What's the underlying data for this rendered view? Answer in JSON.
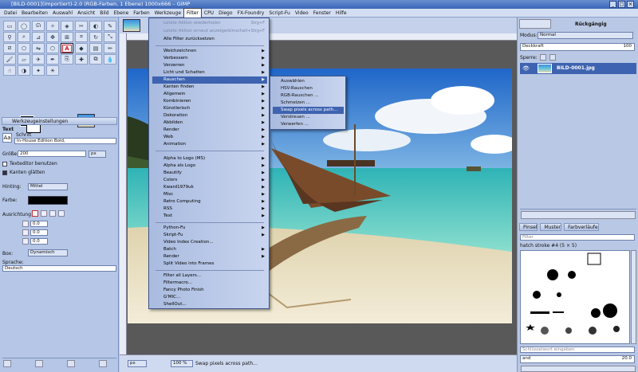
{
  "window": {
    "title": "[BILD-0001](importiert)-2.0 (RGB-Farben, 1 Ebene) 1000x666 – GIMP"
  },
  "menubar": [
    "Datei",
    "Bearbeiten",
    "Auswahl",
    "Ansicht",
    "Bild",
    "Ebene",
    "Farben",
    "Werkzeuge",
    "Filter",
    "CPU",
    "Diego",
    "FX-Foundry",
    "Script-Fu",
    "Video",
    "Fenster",
    "Hilfe"
  ],
  "active_menu": "Filter",
  "filter_menu": {
    "recent": [
      "Letzte Aktion wiederholen",
      "Letzte Aktion erneut anzeigen",
      "Alle Filter zurücksetzen"
    ],
    "shortcuts": [
      "Strg+F",
      "Umschalt+Strg+F"
    ],
    "groups": [
      [
        "Weichzeichnen",
        "Verbessern",
        "Verzerren",
        "Licht und Schatten",
        "Rauschen",
        "Kanten finden",
        "Allgemein",
        "Kombinieren",
        "Künstlerisch",
        "Dekoration",
        "Abbilden",
        "Render",
        "Web",
        "Animation"
      ],
      [
        "Alpha to Logo (MS)",
        "Alpha als Logo",
        "Beautify",
        "Colors",
        "Kward1979uk",
        "Misc",
        "Retro Computing",
        "RSS",
        "Text"
      ],
      [
        "Python-Fu",
        "Skript-Fu",
        "Video Index Creation...",
        "Batch",
        "Render",
        "Split Video into Frames"
      ],
      [
        "Filter all Layers...",
        "Filtermacro...",
        "Fancy Photo Finish",
        "G'MIC...",
        "ShellOut..."
      ]
    ],
    "highlighted": "Rauschen"
  },
  "noise_submenu": {
    "items": [
      "Auswählen",
      "HSV-Rauschen",
      "RGB-Rauschen ...",
      "Schmelzen ...",
      "Swap pixels across path...",
      "Verstreuen ...",
      "Verwerfen ..."
    ],
    "highlighted": "Swap pixels across path..."
  },
  "tool_options": {
    "header": "Werkzeugeinstellungen",
    "section": "Text",
    "font_label": "Schrift",
    "font_value": "In-House Edition Bold,",
    "size_label": "Größe:",
    "size_value": "200",
    "size_unit": "px",
    "use_editor": "Texteditor benutzen",
    "antialias": "Kanten glätten",
    "hinting_label": "Hinting:",
    "hinting_value": "Mittel",
    "color_label": "Farbe:",
    "justify_label": "Ausrichtung",
    "indent_value": "0.0",
    "line_spacing_value": "0.0",
    "letter_spacing_value": "0.0",
    "box_label": "Box:",
    "box_value": "Dynamisch",
    "language_label": "Sprache:",
    "language_value": "Deutsch"
  },
  "layers": {
    "mode_label": "Modus:",
    "mode_value": "Normal",
    "opacity_label": "Deckkraft",
    "opacity_value": "100",
    "lock_label": "Sperre:",
    "layer_name": "BILD-0001.jpg",
    "undo_label": "Rückgängig"
  },
  "brushes": {
    "tabs": [
      "Pinsel",
      "Muster",
      "Farbverläufe"
    ],
    "filter_placeholder": "Filter",
    "brush_name": "hatch stroke #4 (5 × 5)",
    "tag_placeholder": "Schlüsselwort eingeben",
    "spacing_label": "and",
    "spacing_value": "20.0"
  },
  "status": {
    "unit": "px",
    "zoom": "100 %",
    "message": "Swap pixels across path..."
  },
  "colors": {
    "accent": "#3e63b0",
    "menu_bg": "#c9d5ef",
    "title_bg": "#3a66b8"
  }
}
